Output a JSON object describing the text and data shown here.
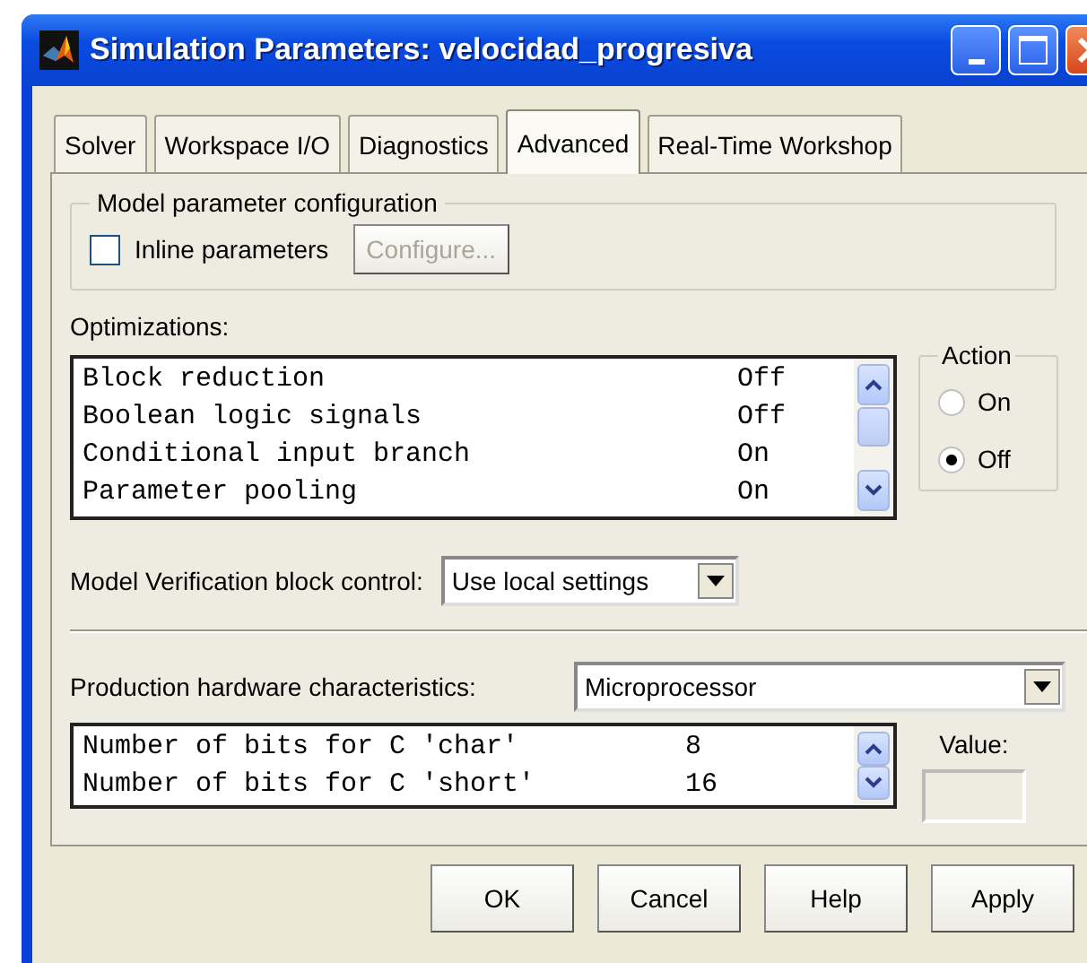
{
  "window": {
    "title": "Simulation Parameters: velocidad_progresiva"
  },
  "tabs": [
    {
      "label": "Solver",
      "selected": false
    },
    {
      "label": "Workspace I/O",
      "selected": false
    },
    {
      "label": "Diagnostics",
      "selected": false
    },
    {
      "label": "Advanced",
      "selected": true
    },
    {
      "label": "Real-Time Workshop",
      "selected": false
    }
  ],
  "model_parameter_configuration": {
    "title": "Model parameter configuration",
    "inline_parameters": {
      "label": "Inline parameters",
      "checked": false
    },
    "configure_button": {
      "label": "Configure...",
      "disabled": true
    }
  },
  "optimizations": {
    "label": "Optimizations:",
    "rows": [
      {
        "name": "Block reduction",
        "value": "Off"
      },
      {
        "name": "Boolean logic signals",
        "value": "Off"
      },
      {
        "name": "Conditional input branch",
        "value": "On"
      },
      {
        "name": "Parameter pooling",
        "value": "On"
      }
    ]
  },
  "action": {
    "title": "Action",
    "options": [
      {
        "label": "On",
        "selected": false
      },
      {
        "label": "Off",
        "selected": true
      }
    ]
  },
  "model_verification": {
    "label": "Model Verification block control:",
    "value": "Use local settings"
  },
  "production_hardware": {
    "label": "Production hardware characteristics:",
    "value": "Microprocessor",
    "rows": [
      {
        "name": "Number of bits for C 'char'",
        "value": "8"
      },
      {
        "name": "Number of bits for C 'short'",
        "value": "16"
      }
    ],
    "value_label": "Value:"
  },
  "buttons": [
    {
      "label": "OK"
    },
    {
      "label": "Cancel"
    },
    {
      "label": "Help"
    },
    {
      "label": "Apply"
    }
  ]
}
